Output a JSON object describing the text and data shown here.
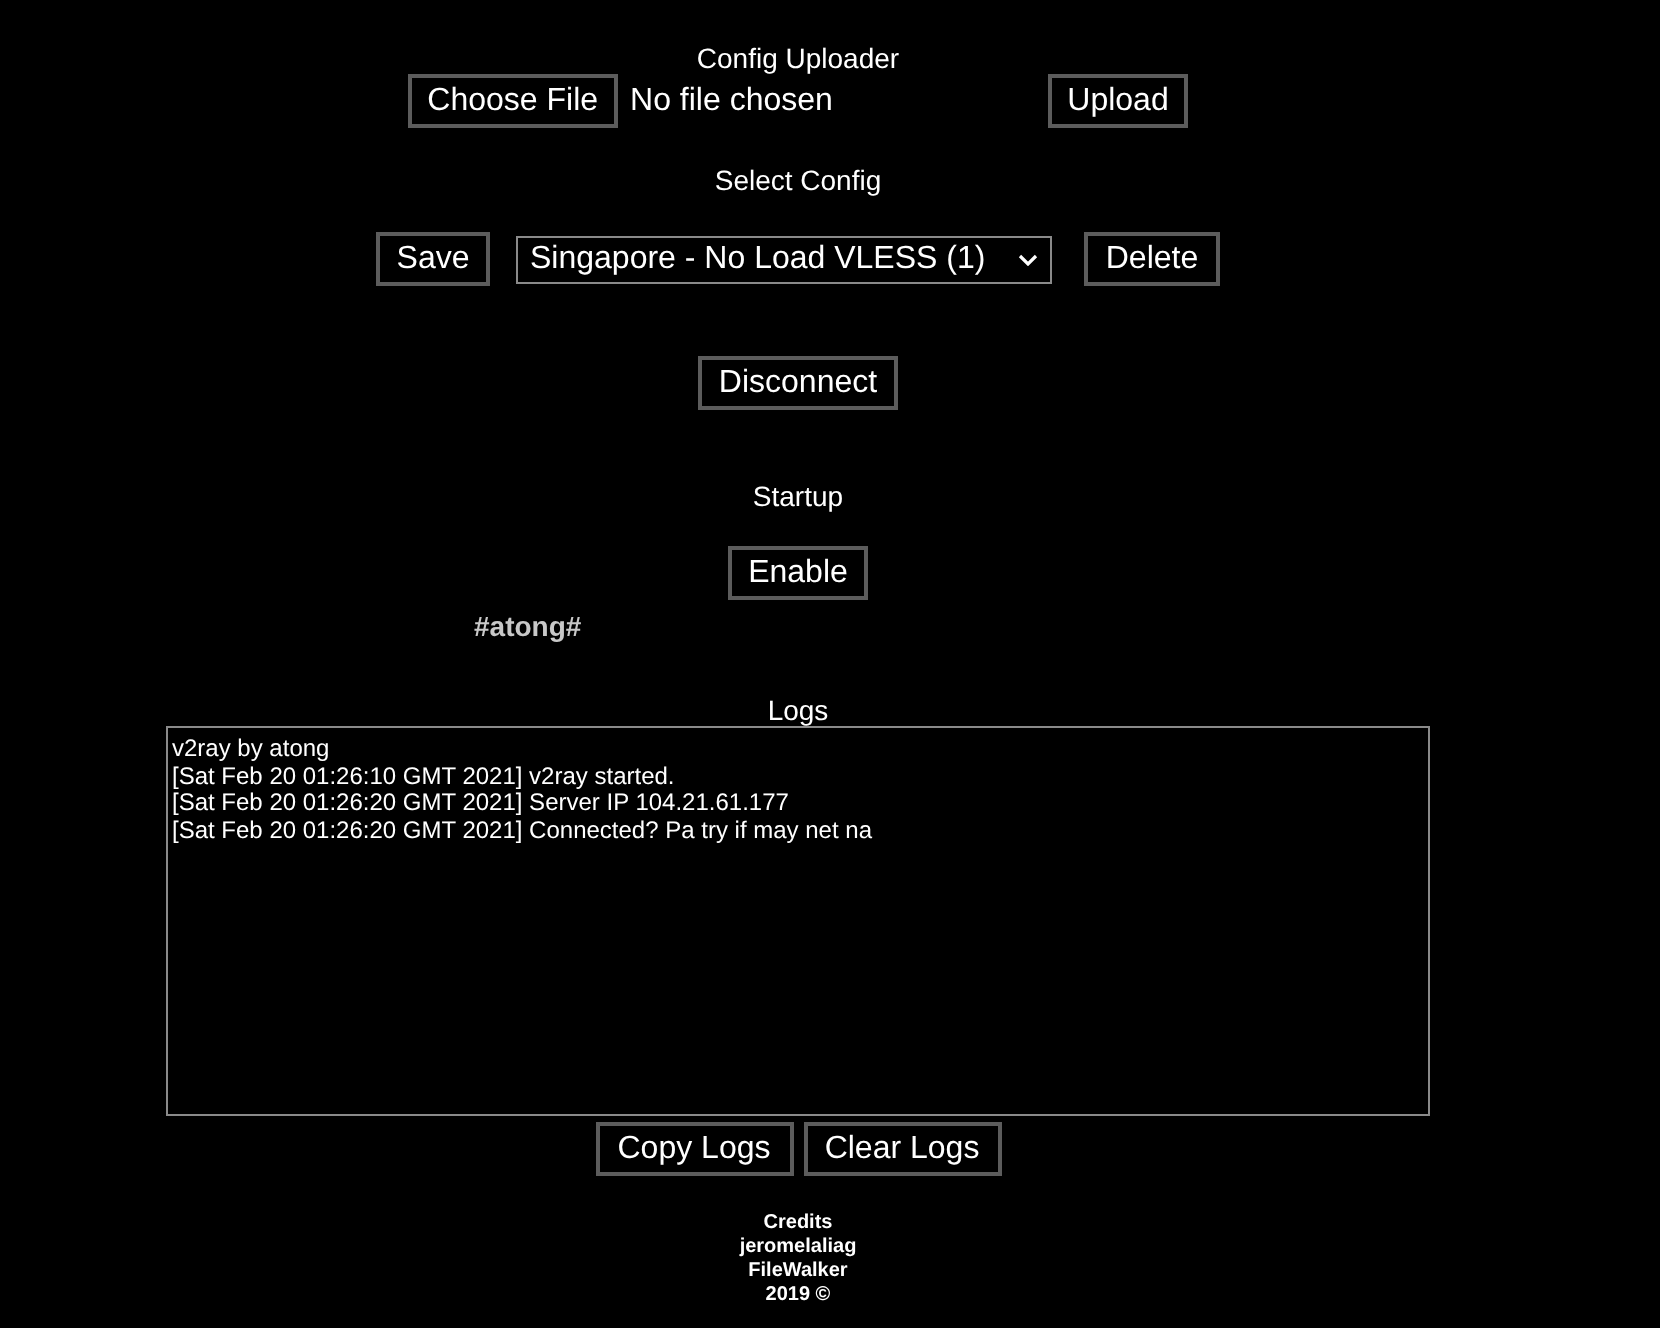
{
  "uploader": {
    "title": "Config Uploader",
    "choose_button": "Choose File",
    "file_status": "No file chosen",
    "upload_button": "Upload"
  },
  "config": {
    "title": "Select Config",
    "save_button": "Save",
    "selected_option": "Singapore - No Load VLESS (1)",
    "delete_button": "Delete"
  },
  "connection": {
    "button": "Disconnect"
  },
  "startup": {
    "title": "Startup",
    "button": "Enable"
  },
  "tag": "#atong#",
  "logs": {
    "title": "Logs",
    "lines": [
      "v2ray by atong",
      "[Sat Feb 20 01:26:10 GMT 2021] v2ray started.",
      "[Sat Feb 20 01:26:20 GMT 2021] Server IP 104.21.61.177",
      "[Sat Feb 20 01:26:20 GMT 2021] Connected? Pa try if may net na"
    ],
    "buttons": [
      "Copy Logs",
      "Clear Logs"
    ]
  },
  "credits": [
    "Credits",
    "jeromelaliag",
    "FileWalker",
    "2019 ©"
  ]
}
